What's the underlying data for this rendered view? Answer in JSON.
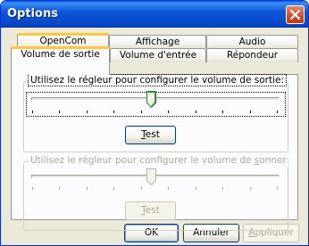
{
  "window": {
    "title": "Options"
  },
  "tabs": {
    "row_top": [
      "OpenCom",
      "Affichage",
      "Audio"
    ],
    "row_bottom": [
      "Volume de sortie",
      "Volume d'entrée",
      "Répondeur"
    ]
  },
  "output_group": {
    "label": "Utilisez le régleur pour configurer le volume de sortie:",
    "test_label_underlined": "T",
    "test_label_rest": "est",
    "slider_level": 0.375
  },
  "ring_group": {
    "label_prefix": "Utilisez le régleur pour configurer le volume de ",
    "label_underlined": "s",
    "label_suffix": "onner:",
    "test_label_underlined": "T",
    "test_label_rest": "est",
    "slider_level": 0.375
  },
  "buttons": {
    "ok": "OK",
    "cancel": "Annuler",
    "apply_underlined": "A",
    "apply_rest": "ppliquer"
  },
  "colors": {
    "title_bar": "#0b58d6",
    "tab_highlight": "#ffc83c",
    "close_button": "#d4492a",
    "face": "#ece9d8"
  },
  "icons": {
    "close": "close-icon"
  }
}
